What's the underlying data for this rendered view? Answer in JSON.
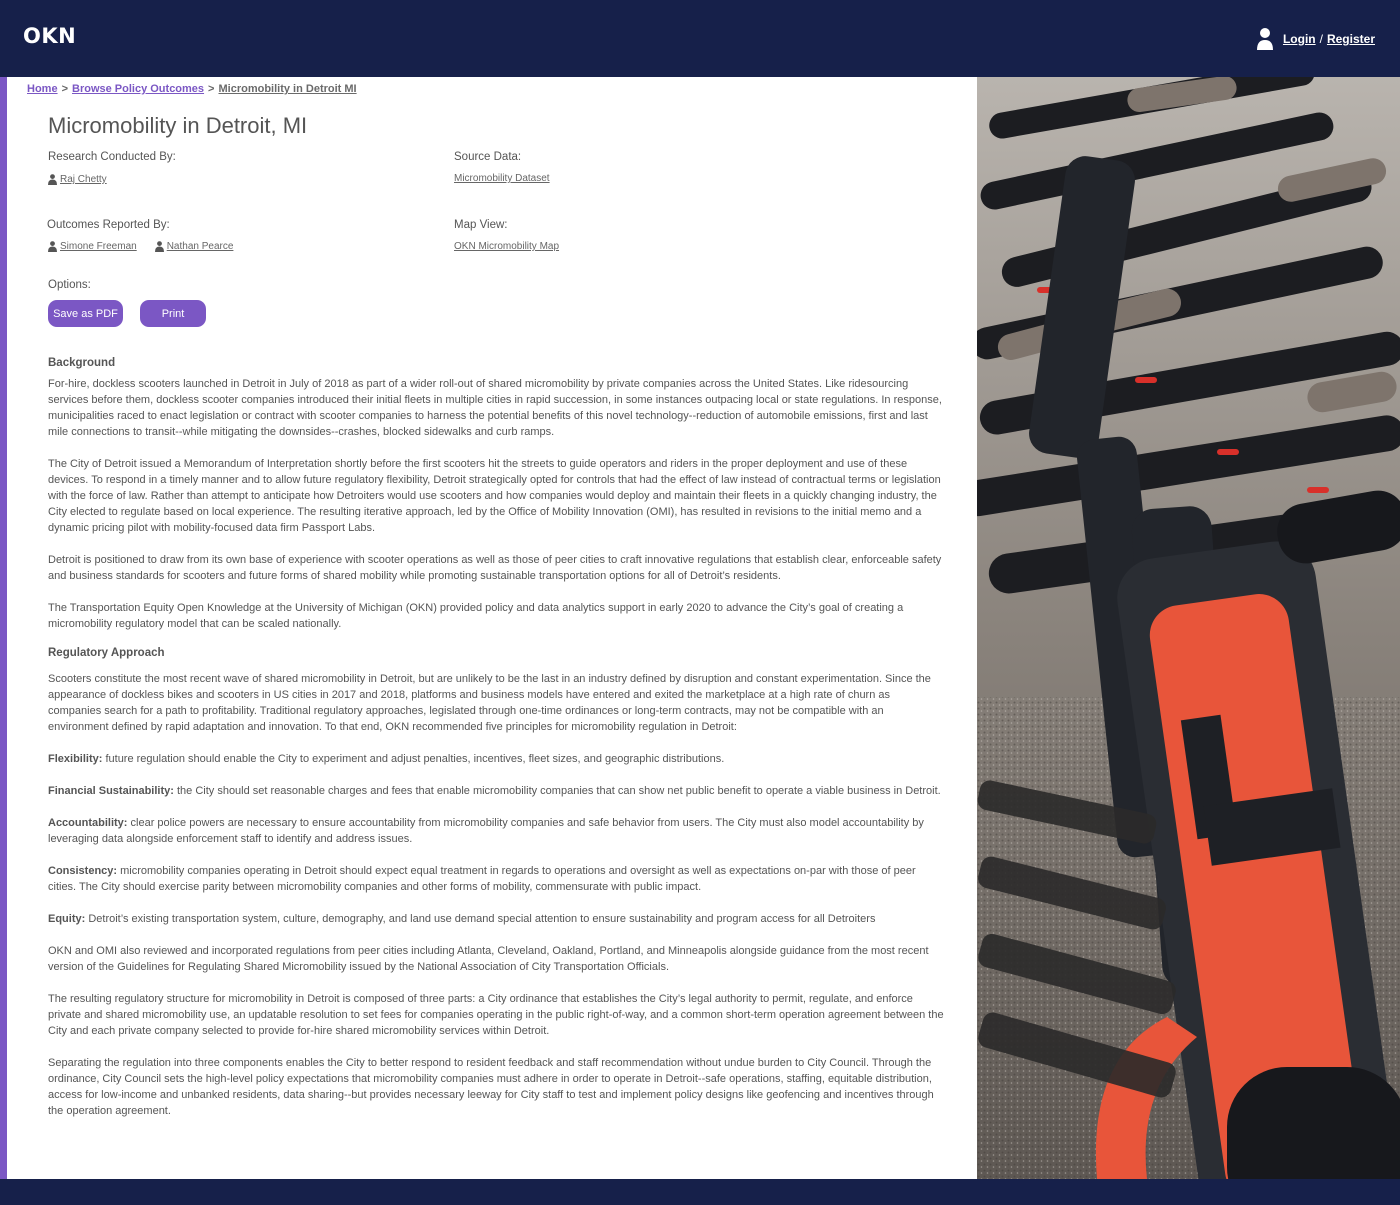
{
  "header": {
    "logo": "OKN",
    "login": "Login",
    "separator": "/",
    "register": "Register"
  },
  "breadcrumb": {
    "home": "Home",
    "browse": "Browse Policy Outcomes",
    "current": "Micromobility in Detroit MI",
    "sep": ">"
  },
  "page": {
    "title": "Micromobility in Detroit, MI",
    "research_label": "Research Conducted By:",
    "researcher": "Raj Chetty",
    "source_label": "Source Data:",
    "source_link": "Micromobility Dataset",
    "outcomes_label": "Outcomes Reported By:",
    "reporters": [
      "Simone Freeman",
      "Nathan Pearce"
    ],
    "map_label": "Map View:",
    "map_link": "OKN Micromobility Map",
    "options_label": "Options:",
    "save_pdf": "Save as PDF",
    "print": "Print"
  },
  "article": {
    "background_heading": "Background",
    "background": [
      "For-hire, dockless scooters launched in Detroit in July of 2018 as part of a wider roll-out of shared micromobility by private companies across the United States. Like ridesourcing services before them, dockless scooter companies introduced their initial fleets in multiple cities in rapid succession, in some instances outpacing local or state regulations. In response, municipalities raced to enact legislation or contract with scooter companies to harness the potential benefits of this novel technology--reduction of automobile emissions, first and last mile connections to transit--while mitigating the downsides--crashes, blocked sidewalks and curb ramps.",
      "The City of Detroit issued a Memorandum of Interpretation shortly before the first scooters hit the streets to guide operators and riders in the proper deployment and use of these devices. To respond in a timely manner and to allow future regulatory flexibility, Detroit strategically opted for controls that had the effect of law instead of contractual terms or legislation with the force of law. Rather than attempt to anticipate how Detroiters would use scooters and how companies would deploy and maintain their fleets in a quickly changing industry, the City elected to regulate based on local experience. The resulting iterative approach, led by the Office of Mobility Innovation (OMI), has resulted in revisions to the initial memo and a dynamic pricing pilot with mobility-focused data firm Passport Labs.",
      "Detroit is positioned to draw from its own base of experience with scooter operations as well as those of peer cities to craft innovative regulations that establish clear, enforceable safety and business standards for scooters and future forms of shared mobility while promoting sustainable transportation options for all of Detroit’s residents.",
      "The Transportation Equity Open Knowledge at the University of Michigan (OKN) provided policy and data analytics support in early 2020 to advance the City’s goal of creating a micromobility regulatory model that can be scaled nationally."
    ],
    "regulatory_heading": "Regulatory Approach",
    "regulatory_intro": "Scooters constitute the most recent wave of shared micromobility in Detroit, but are unlikely to be the last in an industry defined by disruption and constant experimentation. Since the appearance of dockless bikes and scooters in US cities in 2017 and 2018, platforms and business models have entered and exited the marketplace at a high rate of churn as companies search for a path to profitability. Traditional regulatory approaches, legislated through one-time ordinances or long-term contracts, may not be compatible with an environment defined by rapid adaptation and innovation. To that end, OKN recommended five principles for micromobility regulation in Detroit:",
    "principles": [
      {
        "term": "Flexibility:",
        "text": " future regulation should enable the City to experiment and adjust penalties, incentives, fleet sizes, and geographic distributions."
      },
      {
        "term": "Financial Sustainability:",
        "text": " the City should set reasonable charges and fees that enable micromobility companies that can show net public benefit to operate a viable business in Detroit."
      },
      {
        "term": "Accountability:",
        "text": " clear police powers are necessary to ensure accountability from micromobility companies and safe behavior from users. The City must also model accountability by leveraging data alongside enforcement staff to identify and address issues."
      },
      {
        "term": "Consistency:",
        "text": " micromobility companies operating in Detroit should expect equal treatment in regards to operations and oversight as well as expectations on-par with those of peer cities. The City should exercise parity between micromobility companies and other forms of mobility, commensurate with public impact."
      },
      {
        "term": "Equity:",
        "text": " Detroit’s existing transportation system, culture, demography, and land use demand special attention to ensure sustainability and program access for all Detroiters"
      }
    ],
    "closing": [
      "OKN and OMI also reviewed and incorporated regulations from peer cities including Atlanta, Cleveland, Oakland, Portland, and Minneapolis alongside guidance from the most recent version of the Guidelines for Regulating Shared Micromobility issued by the National Association of City Transportation Officials.",
      "The resulting regulatory structure for micromobility in Detroit is composed of three parts: a City ordinance that establishes the City’s legal authority to permit, regulate, and enforce private and shared micromobility use, an updatable resolution to set fees for companies operating in the public right-of-way, and a common short-term operation agreement between the City and each private company selected to provide for-hire shared micromobility services within Detroit.",
      "Separating the regulation into three components enables the City to better respond to resident feedback and staff recommendation without undue burden to City Council. Through the ordinance, City Council sets the high-level policy expectations that micromobility companies must adhere in order to operate in Detroit--safe operations, staffing, equitable distribution, access for low-income and unbanked residents, data sharing--but provides necessary leeway for City staff to test and implement policy designs like geofencing and incentives through the operation agreement."
    ]
  },
  "colors": {
    "navy": "#16204a",
    "accent": "#7b57c4",
    "scooter_orange": "#e8553a"
  },
  "icons": {
    "user": "user-icon",
    "person": "person-icon"
  }
}
